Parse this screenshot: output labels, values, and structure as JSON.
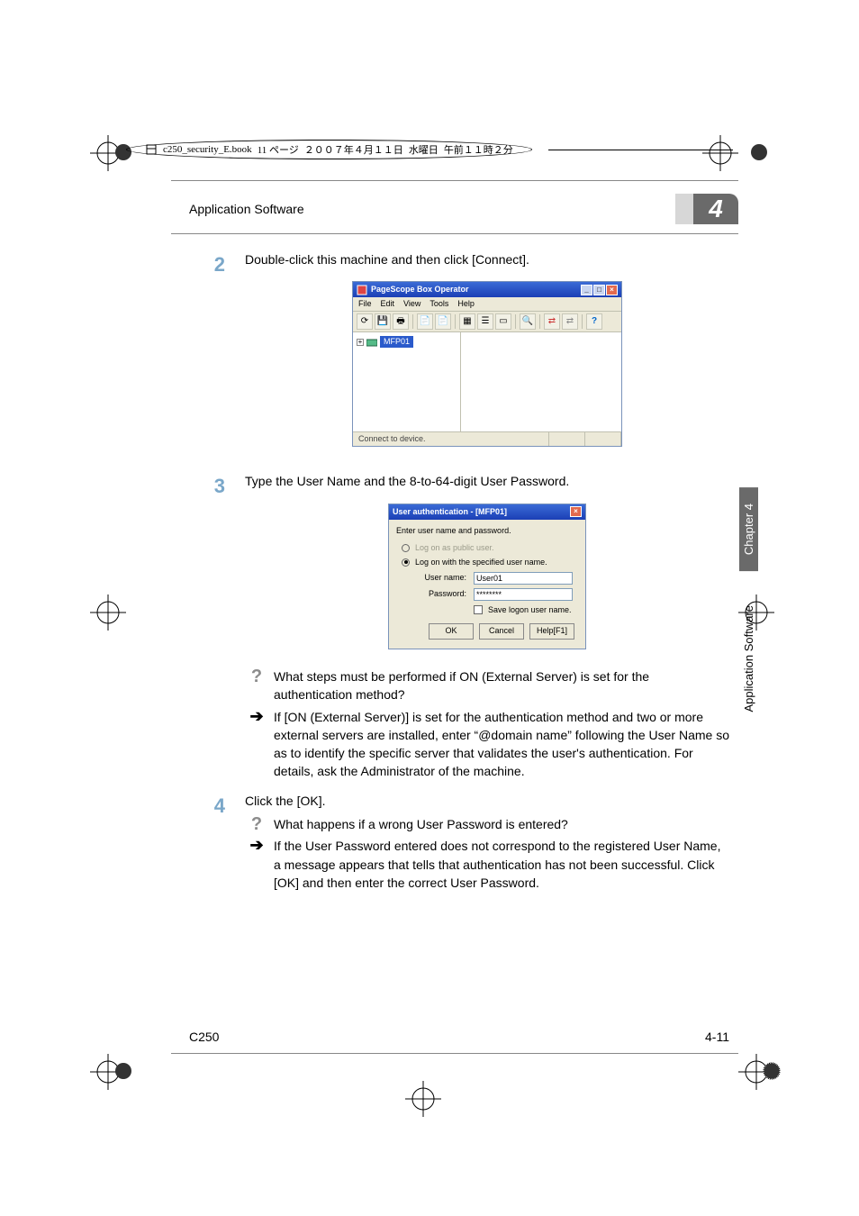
{
  "book_info": {
    "filename": "c250_security_E.book",
    "page_label": "11 ページ",
    "date": "２００７年４月１１日",
    "weekday": "水曜日",
    "time": "午前１１時２分"
  },
  "header": {
    "section_title": "Application Software",
    "chapter_number": "4"
  },
  "side_tabs": {
    "chapter": "Chapter 4",
    "section": "Application Software"
  },
  "steps": {
    "s2": {
      "num": "2",
      "text": "Double-click this machine and then click [Connect]."
    },
    "s3": {
      "num": "3",
      "text": "Type the User Name and the 8-to-64-digit User Password."
    },
    "s4": {
      "num": "4",
      "text": "Click the [OK]."
    }
  },
  "fig1": {
    "title": "PageScope Box Operator",
    "menu": {
      "file": "File",
      "edit": "Edit",
      "view": "View",
      "tools": "Tools",
      "help": "Help"
    },
    "tree_node": "MFP01",
    "status": "Connect to device.",
    "tb_help": "?"
  },
  "fig2": {
    "title": "User authentication - [MFP01]",
    "hdr": "Enter user name and password.",
    "radio1": "Log on as public user.",
    "radio2": "Log on with the specified user name.",
    "user_label": "User name:",
    "user_value": "User01",
    "pass_label": "Password:",
    "pass_value": "********",
    "save_chk": "Save logon user name.",
    "ok": "OK",
    "cancel": "Cancel",
    "help": "Help[F1]"
  },
  "qa": {
    "q1": "What steps must be performed if ON (External Server) is set for the authentication method?",
    "a1": "If [ON (External Server)] is set for the authentication method and two or more external servers are installed, enter “@domain name” following the User Name so as to identify the specific server that validates the user's authentication. For details, ask the Administrator of the machine.",
    "q2": "What happens if a wrong User Password is entered?",
    "a2": "If the User Password entered does not correspond to the registered User Name, a message appears that tells that authentication has not been successful. Click [OK] and then enter the correct User Password."
  },
  "footer": {
    "model": "C250",
    "page": "4-11"
  }
}
